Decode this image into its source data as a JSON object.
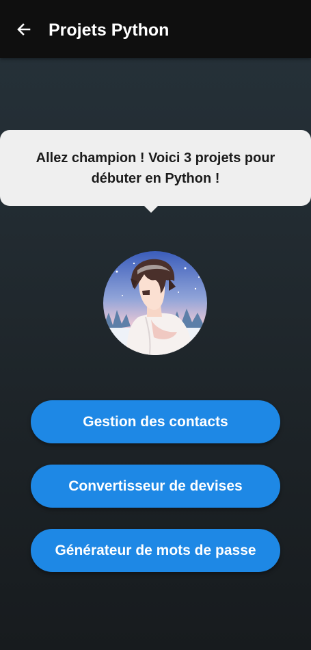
{
  "app_bar": {
    "back_icon": "arrow-left-icon",
    "title": "Projets Python"
  },
  "speech_bubble": {
    "text": "Allez champion ! Voici 3 projets pour débuter en Python !"
  },
  "avatar": {
    "description_icon": "anime-boy-avatar"
  },
  "projects": [
    {
      "label": "Gestion des contacts"
    },
    {
      "label": "Convertisseur de devises"
    },
    {
      "label": "Générateur de mots de passe"
    }
  ],
  "colors": {
    "app_bar": "#0f0f0f",
    "accent": "#1e88e5",
    "bubble": "#efefef"
  }
}
